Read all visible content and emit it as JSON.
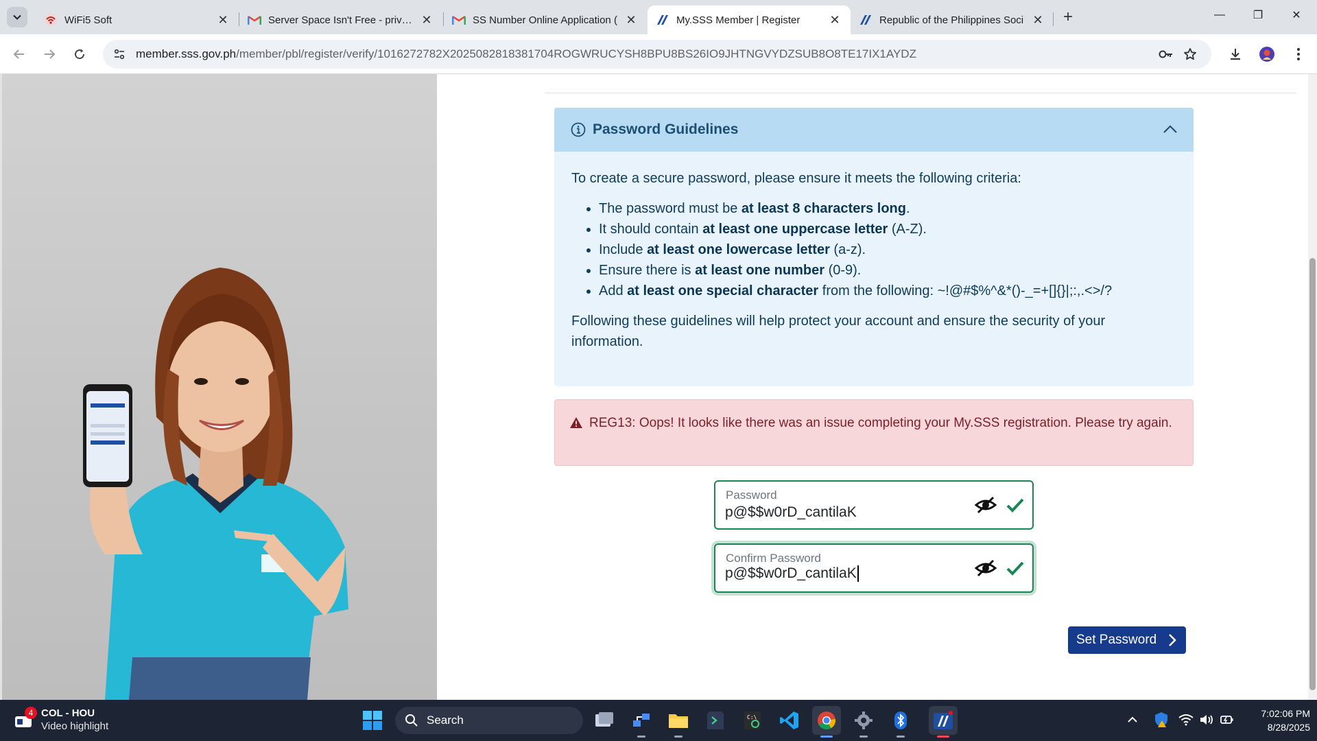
{
  "browser": {
    "tabs": [
      {
        "title": "WiFi5 Soft",
        "active": false
      },
      {
        "title": "Server Space Isn't Free - private",
        "active": false
      },
      {
        "title": "SS Number Online Application (",
        "active": false
      },
      {
        "title": "My.SSS Member | Register",
        "active": true
      },
      {
        "title": "Republic of the Philippines Soci",
        "active": false
      }
    ],
    "close_glyph": "✕",
    "new_tab_glyph": "+",
    "window_controls": {
      "minimize": "—",
      "restore": "❐",
      "close": "✕"
    },
    "url_domain": "member.sss.gov.ph",
    "url_path": "/member/pbl/register/verify/1016272782X2025082818381704ROGWRUCYSH8BPU8BS26IO9JHTNGVYDZSUB8O8TE17IX1AYDZ"
  },
  "guidelines": {
    "title": "Password Guidelines",
    "intro": "To create a secure password, please ensure it meets the following criteria:",
    "items": [
      {
        "pre": "The password must be ",
        "bold": "at least 8 characters long",
        "post": "."
      },
      {
        "pre": "It should contain ",
        "bold": "at least one uppercase letter",
        "post": " (A-Z)."
      },
      {
        "pre": "Include ",
        "bold": "at least one lowercase letter",
        "post": " (a-z)."
      },
      {
        "pre": "Ensure there is ",
        "bold": "at least one number",
        "post": " (0-9)."
      },
      {
        "pre": "Add ",
        "bold": "at least one special character",
        "post": " from the following: ~!@#$%^&*()-_=+[]{}|;:,.<>/?"
      }
    ],
    "outro": "Following these guidelines will help protect your account and ensure the security of your information."
  },
  "alert": {
    "message": "REG13: Oops! It looks like there was an issue completing your My.SSS registration. Please try again."
  },
  "form": {
    "password_label": "Password",
    "password_value": "p@$$w0rD_cantilaK",
    "confirm_label": "Confirm Password",
    "confirm_value": "p@$$w0rD_cantilaK",
    "submit_label": "Set Password"
  },
  "taskbar": {
    "news_title": "COL - HOU",
    "news_subtitle": "Video highlight",
    "news_badge": "4",
    "search_label": "Search",
    "time": "7:02:06 PM",
    "date": "8/28/2025"
  },
  "colors": {
    "accent_blue": "#163b8c",
    "success_green": "#198754",
    "alert_bg": "#f8d7da",
    "info_bg": "#e8f3fb"
  }
}
